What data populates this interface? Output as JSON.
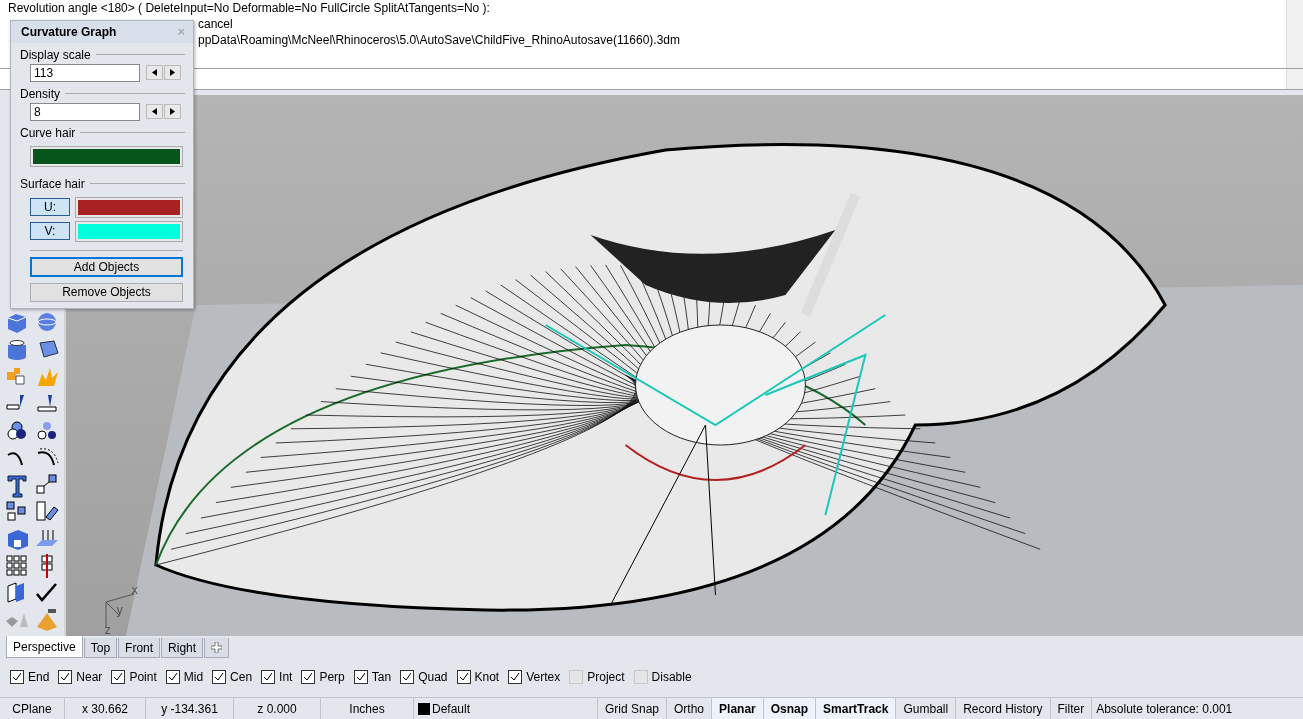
{
  "command_history": [
    {
      "text": "Revolution angle <180> ( DeleteInput=No  Deformable=No  FullCircle  SplitAtTangents=No ):"
    },
    {
      "text": "cancel",
      "partly_hidden": true
    },
    {
      "text": "ppData\\Roaming\\McNeel\\Rhinoceros\\5.0\\AutoSave\\ChildFive_RhinoAutosave(11660).3dm",
      "partly_hidden": true
    }
  ],
  "curvature_graph": {
    "title": "Curvature Graph",
    "close": "×",
    "display_scale": {
      "label": "Display scale",
      "value": "113"
    },
    "density": {
      "label": "Density",
      "value": "8"
    },
    "curve_hair": {
      "label": "Curve hair",
      "color": "#06561c"
    },
    "surface_hair": {
      "label": "Surface hair",
      "swatches": [
        {
          "label": "U:",
          "color": "#a82222"
        },
        {
          "label": "V:",
          "color": "#00ffdd"
        }
      ]
    },
    "buttons": [
      {
        "label": "Add Objects",
        "focused": true
      },
      {
        "label": "Remove Objects",
        "focused": false
      }
    ]
  },
  "viewport": {
    "axis_labels": [
      "x",
      "y",
      "z"
    ]
  },
  "viewport_tabs": [
    {
      "label": "Perspective",
      "selected": true
    },
    {
      "label": "Top",
      "selected": false
    },
    {
      "label": "Front",
      "selected": false
    },
    {
      "label": "Right",
      "selected": false
    }
  ],
  "osnaps": [
    {
      "label": "End",
      "checked": true
    },
    {
      "label": "Near",
      "checked": true
    },
    {
      "label": "Point",
      "checked": true
    },
    {
      "label": "Mid",
      "checked": true
    },
    {
      "label": "Cen",
      "checked": true
    },
    {
      "label": "Int",
      "checked": true
    },
    {
      "label": "Perp",
      "checked": true
    },
    {
      "label": "Tan",
      "checked": true
    },
    {
      "label": "Quad",
      "checked": true
    },
    {
      "label": "Knot",
      "checked": true
    },
    {
      "label": "Vertex",
      "checked": true
    },
    {
      "label": "Project",
      "checked": false
    },
    {
      "label": "Disable",
      "checked": false
    }
  ],
  "status_bar": {
    "cplane": "CPlane",
    "coords": [
      "x 30.662",
      "y -134.361",
      "z 0.000"
    ],
    "units": "Inches",
    "layer": {
      "name": "Default",
      "color": "#000000"
    },
    "toggles": [
      {
        "label": "Grid Snap",
        "on": false
      },
      {
        "label": "Ortho",
        "on": false
      },
      {
        "label": "Planar",
        "on": true
      },
      {
        "label": "Osnap",
        "on": true
      },
      {
        "label": "SmartTrack",
        "on": true
      },
      {
        "label": "Gumball",
        "on": false
      },
      {
        "label": "Record History",
        "on": false
      },
      {
        "label": "Filter",
        "on": false
      }
    ],
    "tolerance": "Absolute tolerance: 0.001"
  }
}
